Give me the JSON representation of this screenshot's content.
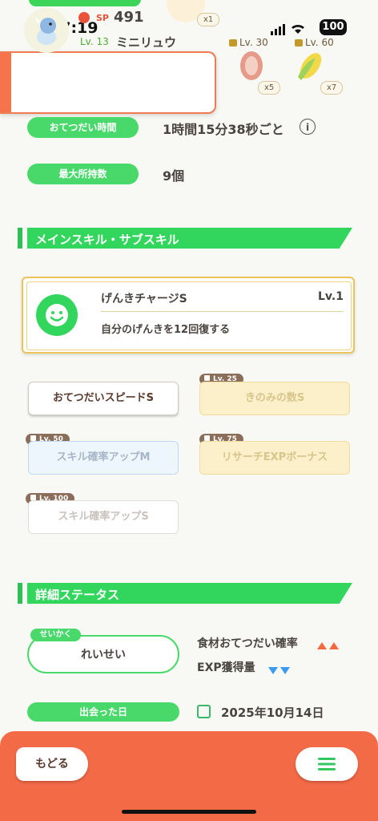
{
  "status_bar": {
    "time": "17:19",
    "battery": "100"
  },
  "top_ingredients": [
    {
      "qty": "x1"
    },
    {
      "locked_level": "Lv. 30",
      "qty": "x5"
    },
    {
      "locked_level": "Lv. 60",
      "qty": "x7"
    }
  ],
  "pokemon": {
    "sp_label": "SP",
    "sp_value": "491",
    "level_label": "Lv. 13",
    "name": "ミニリュウ"
  },
  "info": {
    "help_time_label": "おてつだい時間",
    "help_time_value": "1時間15分38秒ごと",
    "info_icon": "i",
    "max_carry_label": "最大所持数",
    "max_carry_value": "9個"
  },
  "sections": {
    "skills_title": "メインスキル・サブスキル",
    "details_title": "詳細ステータス"
  },
  "main_skill": {
    "name": "げんきチャージS",
    "level": "Lv.1",
    "description": "自分のげんきを12回復する"
  },
  "sub_skills": [
    {
      "label": "おてつだいスピードS",
      "lock": ""
    },
    {
      "label": "きのみの数S",
      "lock": "Lv. 25"
    },
    {
      "label": "スキル確率アップM",
      "lock": "Lv. 50"
    },
    {
      "label": "リサーチEXPボーナス",
      "lock": "Lv. 75"
    },
    {
      "label": "スキル確率アップS",
      "lock": "Lv. 100"
    }
  ],
  "nature": {
    "tag": "せいかく",
    "value": "れいせい",
    "up_label": "食材おてつだい確率",
    "down_label": "EXP獲得量"
  },
  "met_date": {
    "label": "出会った日",
    "value": "2025年10月14日"
  },
  "bottom_bar": {
    "back_label": "もどる"
  },
  "colors": {
    "accent_green": "#33d65d",
    "accent_orange": "#f36a47",
    "gold": "#eac35a"
  }
}
